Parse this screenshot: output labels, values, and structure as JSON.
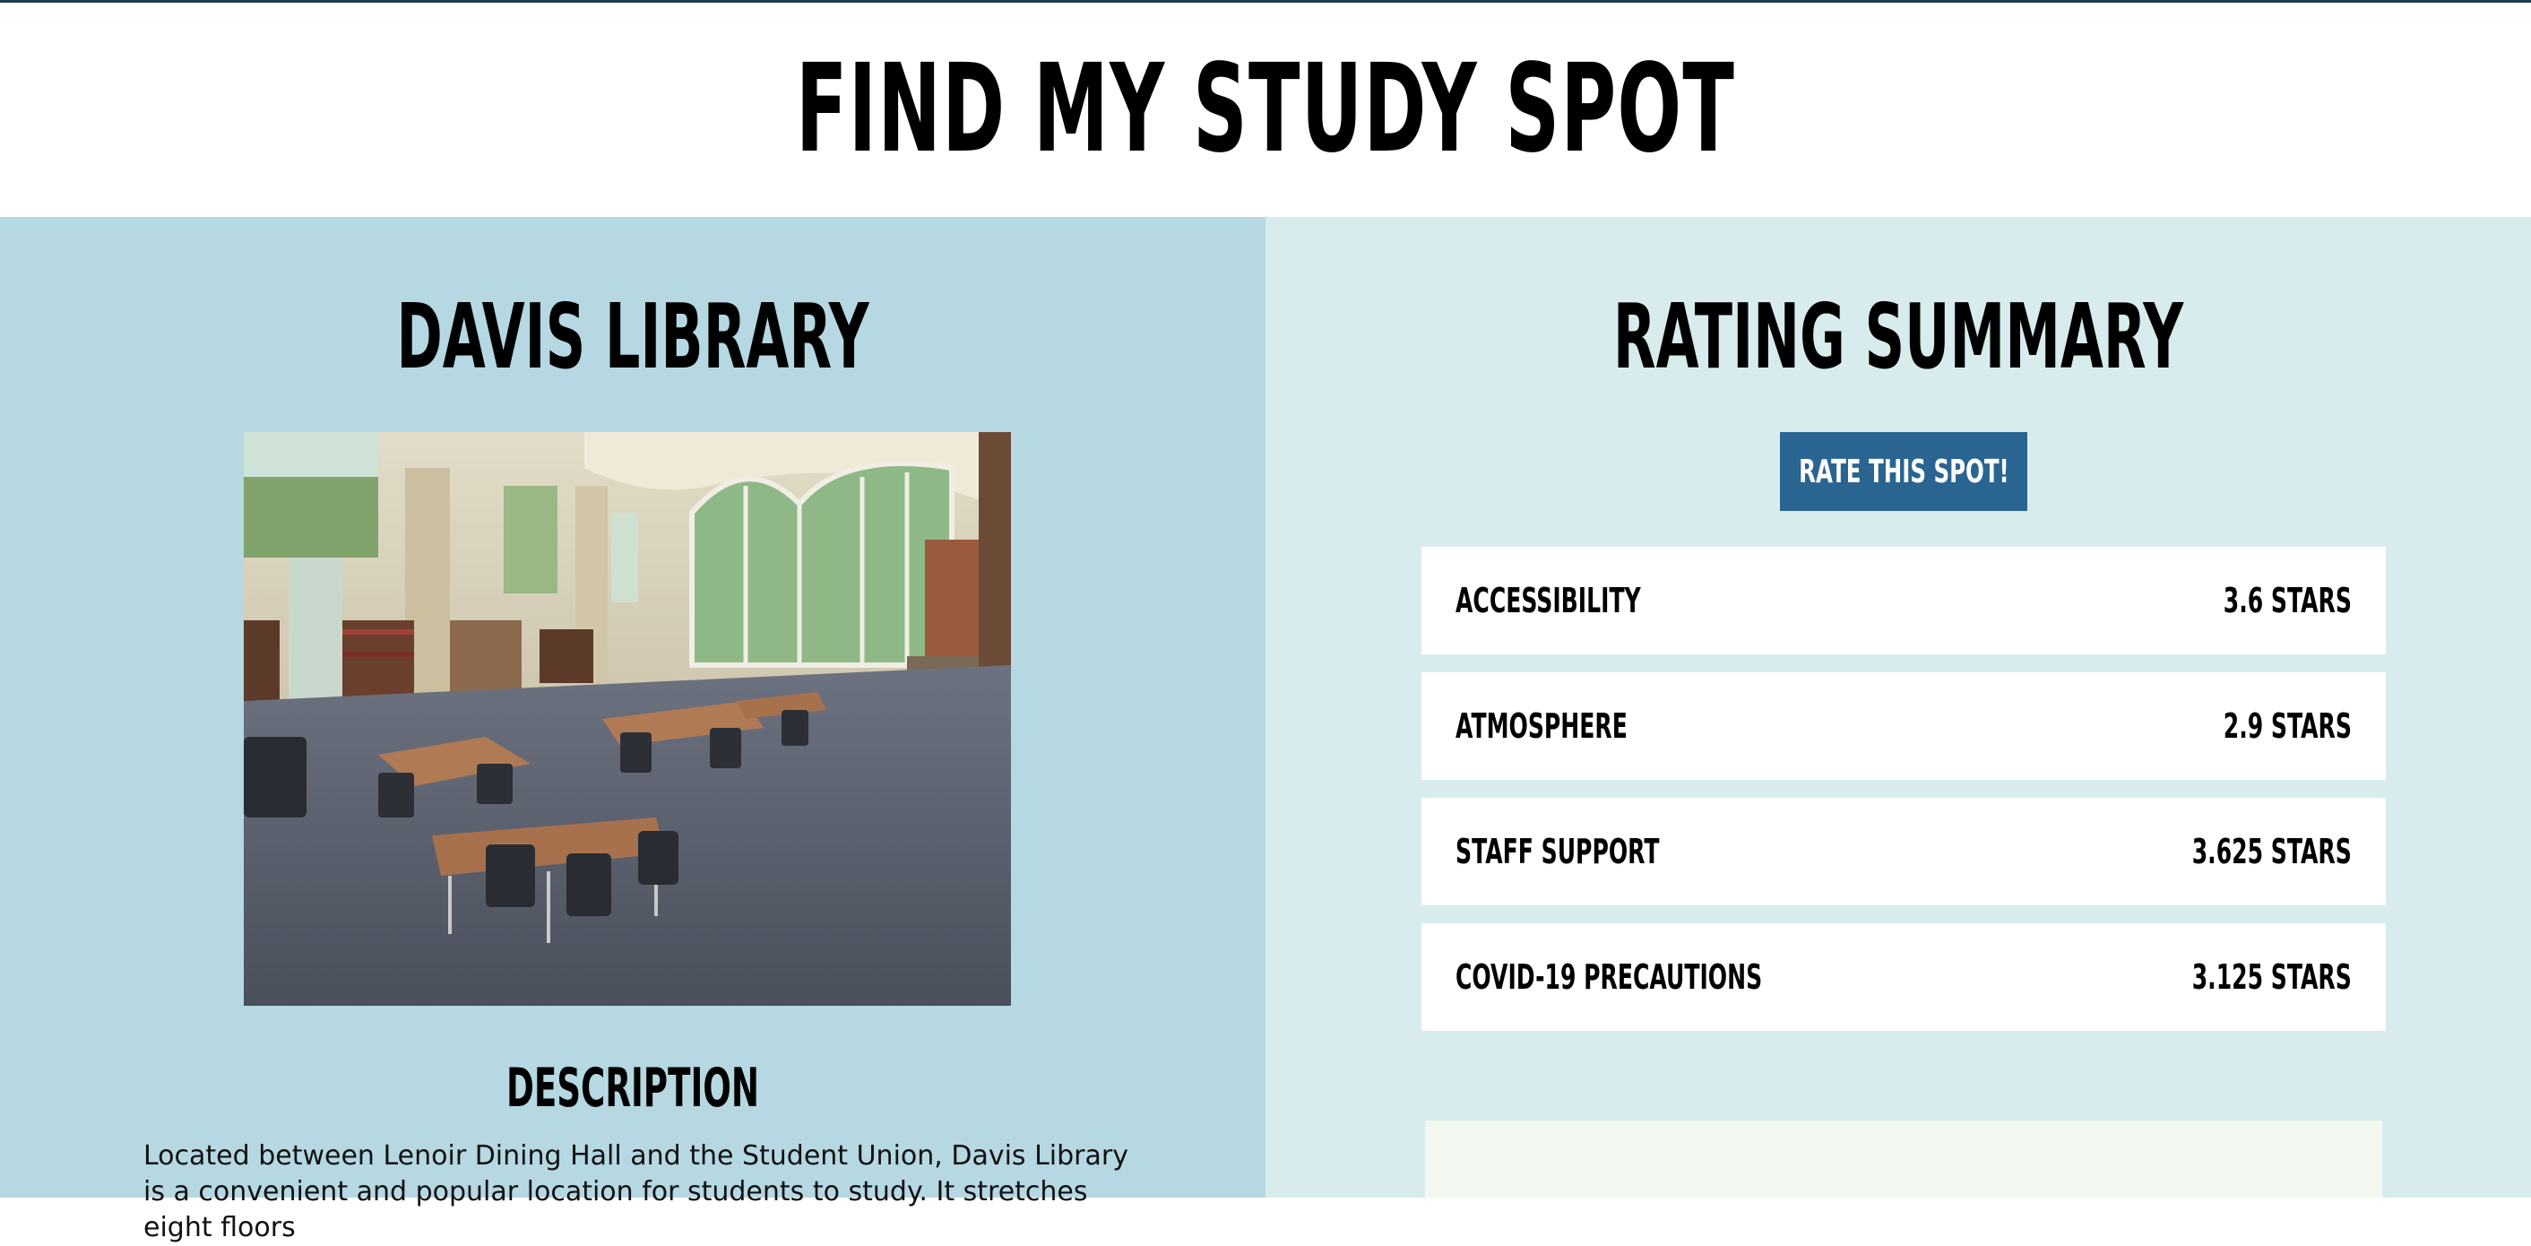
{
  "header": {
    "title": "FIND MY STUDY SPOT"
  },
  "location": {
    "name": "DAVIS LIBRARY",
    "description_heading": "DESCRIPTION",
    "description_text": "Located between Lenoir Dining Hall and the Student Union, Davis Library is a convenient and popular location for students to study. It stretches eight floors"
  },
  "ratings": {
    "heading": "RATING SUMMARY",
    "button_label": "RATE THIS SPOT!",
    "items": [
      {
        "label": "ACCESSIBILITY",
        "value": "3.6 STARS"
      },
      {
        "label": "ATMOSPHERE",
        "value": "2.9 STARS"
      },
      {
        "label": "STAFF SUPPORT",
        "value": "3.625 STARS"
      },
      {
        "label": "COVID-19 PRECAUTIONS",
        "value": "3.125 STARS"
      }
    ]
  },
  "colors": {
    "left_panel": "#b5d8e3",
    "right_panel": "#d8eced",
    "button": "#2a6592"
  }
}
